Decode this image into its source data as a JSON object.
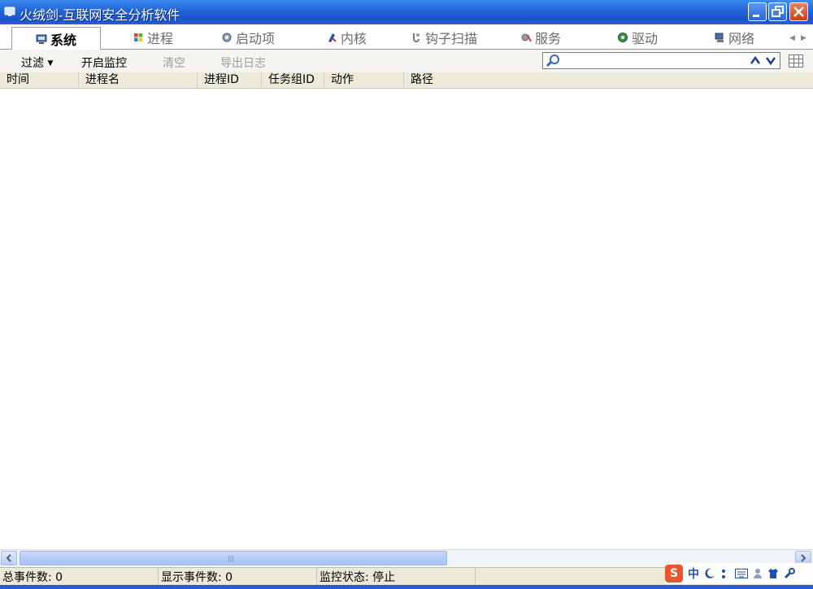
{
  "window": {
    "title": "火绒剑-互联网安全分析软件",
    "accent_color": "#2363d8"
  },
  "tabs": [
    {
      "label": "系统",
      "icon": "monitor-icon",
      "active": true
    },
    {
      "label": "进程",
      "icon": "windows-flag-icon",
      "active": false
    },
    {
      "label": "启动项",
      "icon": "startup-gear-icon",
      "active": false
    },
    {
      "label": "内核",
      "icon": "kernel-icon",
      "active": false
    },
    {
      "label": "钩子扫描",
      "icon": "hook-scan-icon",
      "active": false
    },
    {
      "label": "服务",
      "icon": "service-icon",
      "active": false
    },
    {
      "label": "驱动",
      "icon": "driver-icon",
      "active": false
    },
    {
      "label": "网络",
      "icon": "network-icon",
      "active": false
    }
  ],
  "toolbar": {
    "filter_label": "过滤",
    "start_monitor_label": "开启监控",
    "clear_label": "清空",
    "export_log_label": "导出日志",
    "search_value": "",
    "search_placeholder": ""
  },
  "columns": [
    "时间",
    "进程名",
    "进程ID",
    "任务组ID",
    "动作",
    "路径"
  ],
  "rows": [],
  "status": {
    "total_events": "总事件数: 0",
    "shown_events": "显示事件数: 0",
    "monitor_state": "监控状态: 停止"
  },
  "ime": {
    "logo": "S",
    "mode": "中"
  }
}
